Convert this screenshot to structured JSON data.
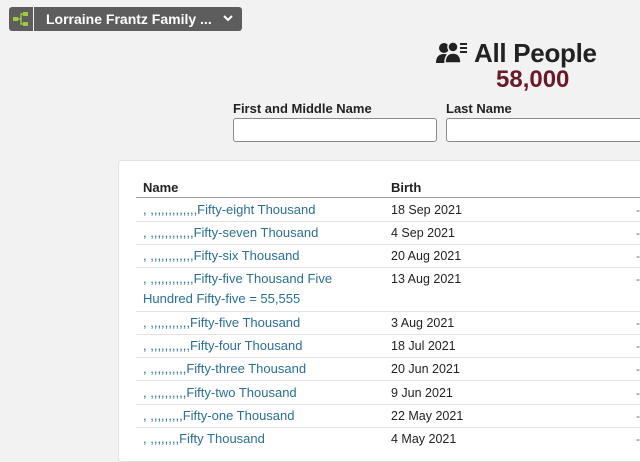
{
  "tree_selector": {
    "icon": "family-tree-icon",
    "label": "Lorraine Frantz Family ..."
  },
  "header": {
    "icon": "people-icon",
    "title": "All People",
    "count": "58,000"
  },
  "filters": {
    "first_name_label": "First and Middle Name",
    "last_name_label": "Last Name",
    "first_name_value": "",
    "last_name_value": ""
  },
  "table": {
    "columns": [
      "Name",
      "Birth"
    ],
    "rows": [
      {
        "name": ", ,,,,,,,,,,,,,Fifty-eight Thousand",
        "birth": "18 Sep 2021"
      },
      {
        "name": ", ,,,,,,,,,,,,Fifty-seven Thousand",
        "birth": "4 Sep 2021"
      },
      {
        "name": ", ,,,,,,,,,,,,Fifty-six Thousand",
        "birth": "20 Aug 2021"
      },
      {
        "name": ", ,,,,,,,,,,,,Fifty-five Thousand Five Hundred Fifty-five = 55,555",
        "birth": "13 Aug 2021"
      },
      {
        "name": ", ,,,,,,,,,,,Fifty-five Thousand",
        "birth": "3 Aug 2021"
      },
      {
        "name": ", ,,,,,,,,,,,Fifty-four Thousand",
        "birth": "18 Jul 2021"
      },
      {
        "name": ", ,,,,,,,,,,Fifty-three Thousand",
        "birth": "20 Jun 2021"
      },
      {
        "name": ", ,,,,,,,,,,Fifty-two Thousand",
        "birth": "9 Jun 2021"
      },
      {
        "name": ", ,,,,,,,,,Fifty-one Thousand",
        "birth": "22 May 2021"
      },
      {
        "name": ", ,,,,,,,,Fifty Thousand",
        "birth": "4 May 2021"
      }
    ]
  }
}
